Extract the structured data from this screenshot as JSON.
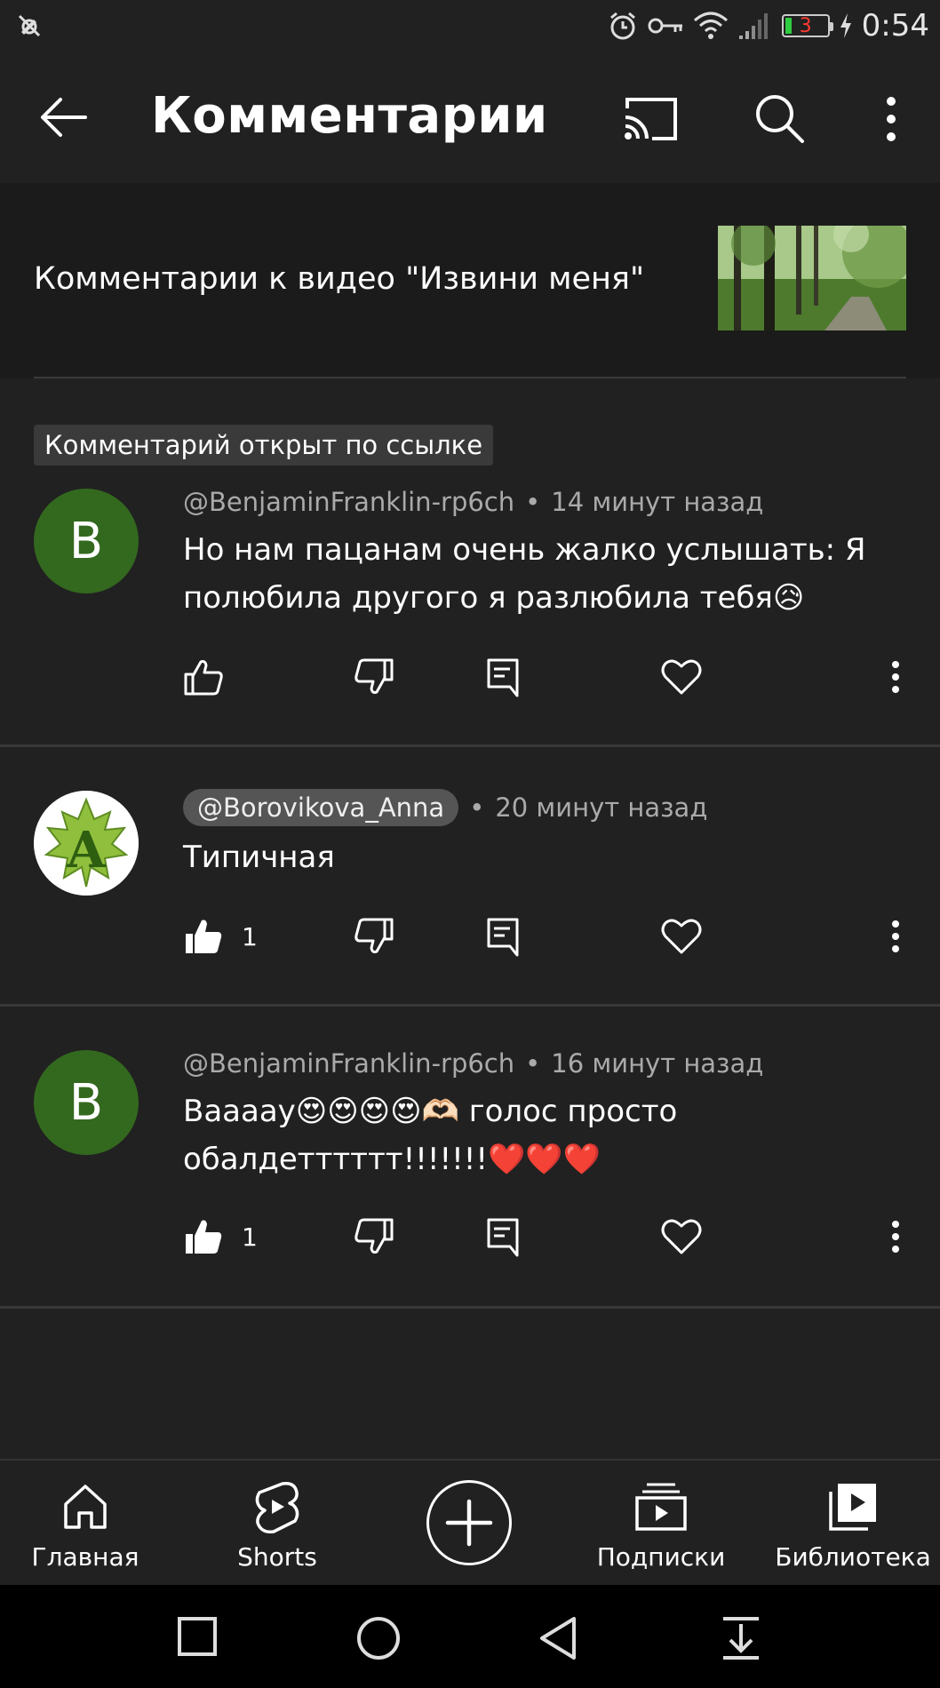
{
  "status_bar": {
    "time": "0:54",
    "battery_level": "3",
    "icons": [
      "notification-off-icon",
      "alarm-icon",
      "key-icon",
      "wifi-icon",
      "signal-icon",
      "battery-icon",
      "charging-icon"
    ]
  },
  "app_bar": {
    "title": "Комментарии",
    "icons": [
      "back-arrow-icon",
      "cast-icon",
      "search-icon",
      "more-vert-icon"
    ]
  },
  "video": {
    "title": "Комментарии к видео \"Извини меня\""
  },
  "linked_label": "Комментарий открыт по ссылке",
  "comments": [
    {
      "avatar_letter": "B",
      "avatar_color": "#33691e",
      "author": "@BenjaminFranklin-rp6ch",
      "time": "14 минут назад",
      "text": "Но нам пацанам очень жалко услышать: Я полюбила другого я разлюбила тебя😥",
      "likes": "",
      "liked": false
    },
    {
      "avatar_letter": "A",
      "avatar_color": "#ffffff",
      "author": "@Borovikova_Anna",
      "time": "20 минут назад",
      "text": "Типичная",
      "likes": "1",
      "liked": true
    },
    {
      "avatar_letter": "B",
      "avatar_color": "#33691e",
      "author": "@BenjaminFranklin-rp6ch",
      "time": "16 минут назад",
      "text": "Вааааy😍😍😍😍🫶🏻 голос просто обалдетттттт!!!!!!!❤️❤️❤️",
      "likes": "1",
      "liked": true
    }
  ],
  "bottom_nav": {
    "items": [
      {
        "label": "Главная",
        "icon": "home-icon"
      },
      {
        "label": "Shorts",
        "icon": "shorts-icon"
      },
      {
        "label": "",
        "icon": "create-plus-icon"
      },
      {
        "label": "Подписки",
        "icon": "subscriptions-icon"
      },
      {
        "label": "Библиотека",
        "icon": "library-icon"
      }
    ]
  },
  "system_nav": {
    "icons": [
      "recents-square-icon",
      "home-circle-icon",
      "back-triangle-icon",
      "notification-pull-icon"
    ]
  },
  "colors": {
    "background": "#212121",
    "header_background": "#1b1b1b",
    "avatar_green": "#33691e",
    "heart_pink": "#e0457b"
  }
}
